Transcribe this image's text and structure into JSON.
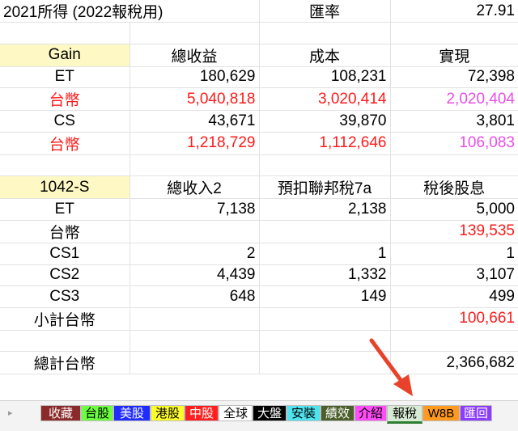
{
  "rows": [
    {
      "cells": [
        "2021所得 (2022報稅用)",
        "",
        "匯率",
        "27.91"
      ]
    },
    {
      "cells": [
        "",
        "",
        "",
        ""
      ]
    },
    {
      "cells": [
        "Gain",
        "總收益",
        "成本",
        "實現"
      ]
    },
    {
      "cells": [
        "ET",
        "180,629",
        "108,231",
        "72,398"
      ]
    },
    {
      "cells": [
        "台幣",
        "5,040,818",
        "3,020,414",
        "2,020,404"
      ]
    },
    {
      "cells": [
        "CS",
        "43,671",
        "39,870",
        "3,801"
      ]
    },
    {
      "cells": [
        "台幣",
        "1,218,729",
        "1,112,646",
        "106,083"
      ]
    },
    {
      "cells": [
        "",
        "",
        "",
        ""
      ]
    },
    {
      "cells": [
        "1042-S",
        "總收入2",
        "預扣聯邦稅7a",
        "稅後股息"
      ]
    },
    {
      "cells": [
        "ET",
        "7,138",
        "2,138",
        "5,000"
      ]
    },
    {
      "cells": [
        "台幣",
        "",
        "",
        "139,535"
      ]
    },
    {
      "cells": [
        "CS1",
        "2",
        "1",
        "1"
      ]
    },
    {
      "cells": [
        "CS2",
        "4,439",
        "1,332",
        "3,107"
      ]
    },
    {
      "cells": [
        "CS3",
        "648",
        "149",
        "499"
      ]
    },
    {
      "cells": [
        "小計台幣",
        "",
        "",
        "100,661"
      ]
    },
    {
      "cells": [
        "",
        "",
        "",
        ""
      ]
    },
    {
      "cells": [
        "總計台幣",
        "",
        "",
        "2,366,682"
      ]
    }
  ],
  "colors": {
    "red_text": "#ff1a1a",
    "pink_text": "#e84ee6",
    "header_highlight": "#fdf8c4",
    "arrow": "#e8432a"
  },
  "tabs": [
    {
      "label": "收藏",
      "bg": "#8b2a2a",
      "fg": "#ffffff"
    },
    {
      "label": "台股",
      "bg": "#6cff3f",
      "fg": "#000000"
    },
    {
      "label": "美股",
      "bg": "#1f2bff",
      "fg": "#ffffff"
    },
    {
      "label": "港股",
      "bg": "#ffff2a",
      "fg": "#000000"
    },
    {
      "label": "中股",
      "bg": "#ff1f1f",
      "fg": "#ffffff"
    },
    {
      "label": "全球",
      "bg": "#ffffff",
      "fg": "#000000"
    },
    {
      "label": "大盤",
      "bg": "#000000",
      "fg": "#ffffff"
    },
    {
      "label": "安裝",
      "bg": "#4fe3ef",
      "fg": "#000000"
    },
    {
      "label": "績效",
      "bg": "#4b5f2a",
      "fg": "#ffffff"
    },
    {
      "label": "介紹",
      "bg": "#ff4cf6",
      "fg": "#000000"
    },
    {
      "label": "報稅",
      "bg": "#d7ead3",
      "fg": "#000000",
      "active": true
    },
    {
      "label": "W8B",
      "bg": "#ff9a1f",
      "fg": "#000000"
    },
    {
      "label": "匯回",
      "bg": "#8a3cff",
      "fg": "#ffffff"
    }
  ],
  "nav": {
    "left_icon": "chevron-left-icon",
    "right_icon": "chevron-right-icon"
  }
}
